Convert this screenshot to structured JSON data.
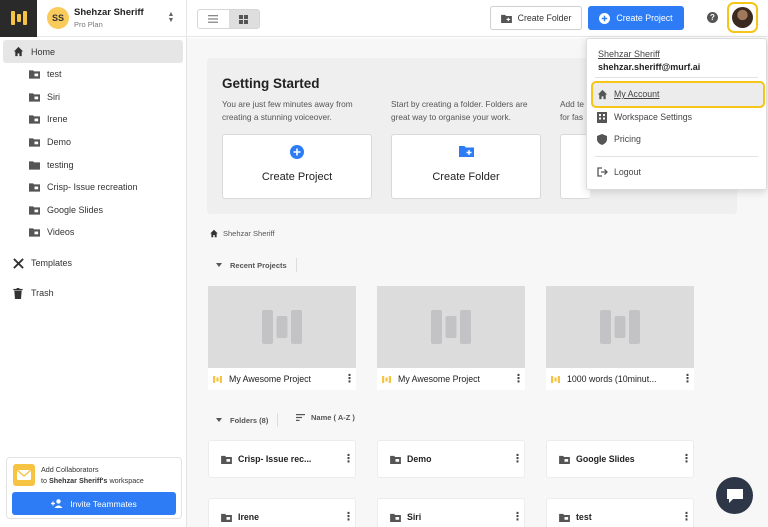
{
  "user": {
    "initials": "SS",
    "name": "Shehzar Sheriff",
    "plan": "Pro Plan",
    "email": "shehzar.sheriff@murf.ai"
  },
  "sidebar": {
    "home_label": "Home",
    "folders": [
      "test",
      "Siri",
      "Irene",
      "Demo",
      "testing",
      "Crisp- Issue recreation",
      "Google Slides",
      "Videos"
    ],
    "templates_label": "Templates",
    "trash_label": "Trash"
  },
  "collab": {
    "line1": "Add Collaborators",
    "line2_prefix": "to",
    "workspace_owner": "Shehzar Sheriff's",
    "line2_suffix": "workspace",
    "invite_label": "Invite Teammates"
  },
  "toolbar": {
    "create_folder_label": "Create Folder",
    "create_project_label": "Create Project",
    "help_glyph": "?"
  },
  "getting_started": {
    "title": "Getting Started",
    "desc1": "You are just few minutes away from creating a stunning voiceover.",
    "desc2": "Start by creating a folder. Folders are great way to organise your work.",
    "desc3_a": "Add te",
    "desc3_b": "for fas",
    "card1_label": "Create Project",
    "card2_label": "Create Folder"
  },
  "breadcrumb": "Shehzar Sheriff",
  "recent": {
    "heading": "Recent Projects",
    "projects": [
      "My Awesome Project",
      "My Awesome Project",
      "1000 words (10minut..."
    ]
  },
  "folders_section": {
    "heading": "Folders (8)",
    "sort_label": "Name ( A-Z )",
    "items": [
      "Crisp- Issue rec...",
      "Demo",
      "Google Slides",
      "Irene",
      "Siri",
      "test"
    ]
  },
  "menu": {
    "my_account": "My Account",
    "workspace_settings": "Workspace Settings",
    "pricing": "Pricing",
    "logout": "Logout"
  },
  "colors": {
    "accent": "#2d7cf6",
    "brand_yellow": "#f6c343",
    "highlight": "#f5c518"
  }
}
